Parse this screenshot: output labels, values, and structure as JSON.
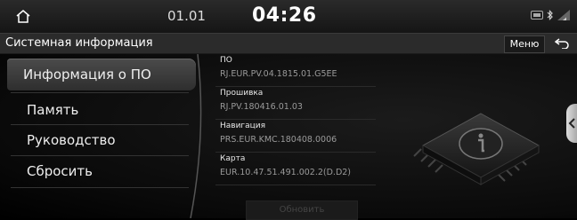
{
  "status": {
    "date": "01.01",
    "time": "04:26"
  },
  "header": {
    "title": "Системная информация",
    "menu_label": "Меню"
  },
  "sidebar": {
    "items": [
      {
        "label": "Информация о ПО",
        "active": true
      },
      {
        "label": "Память",
        "active": false
      },
      {
        "label": "Руководство",
        "active": false
      },
      {
        "label": "Сбросить",
        "active": false
      }
    ]
  },
  "info": {
    "rows": [
      {
        "label": "ПО",
        "value": "RJ.EUR.PV.04.1815.01.G5EE"
      },
      {
        "label": "Прошивка",
        "value": "RJ.PV.180416.01.03"
      },
      {
        "label": "Навигация",
        "value": "PRS.EUR.KMC.180408.0006"
      },
      {
        "label": "Карта",
        "value": "EUR.10.47.51.491.002.2(D.D2)"
      }
    ]
  },
  "actions": {
    "update_label": "Обновить"
  },
  "icons": {
    "home": "home-icon",
    "back": "back-arrow-icon",
    "status": [
      "media-icon",
      "bluetooth-icon",
      "signal-icon"
    ],
    "illustration": "info-chip-icon"
  }
}
